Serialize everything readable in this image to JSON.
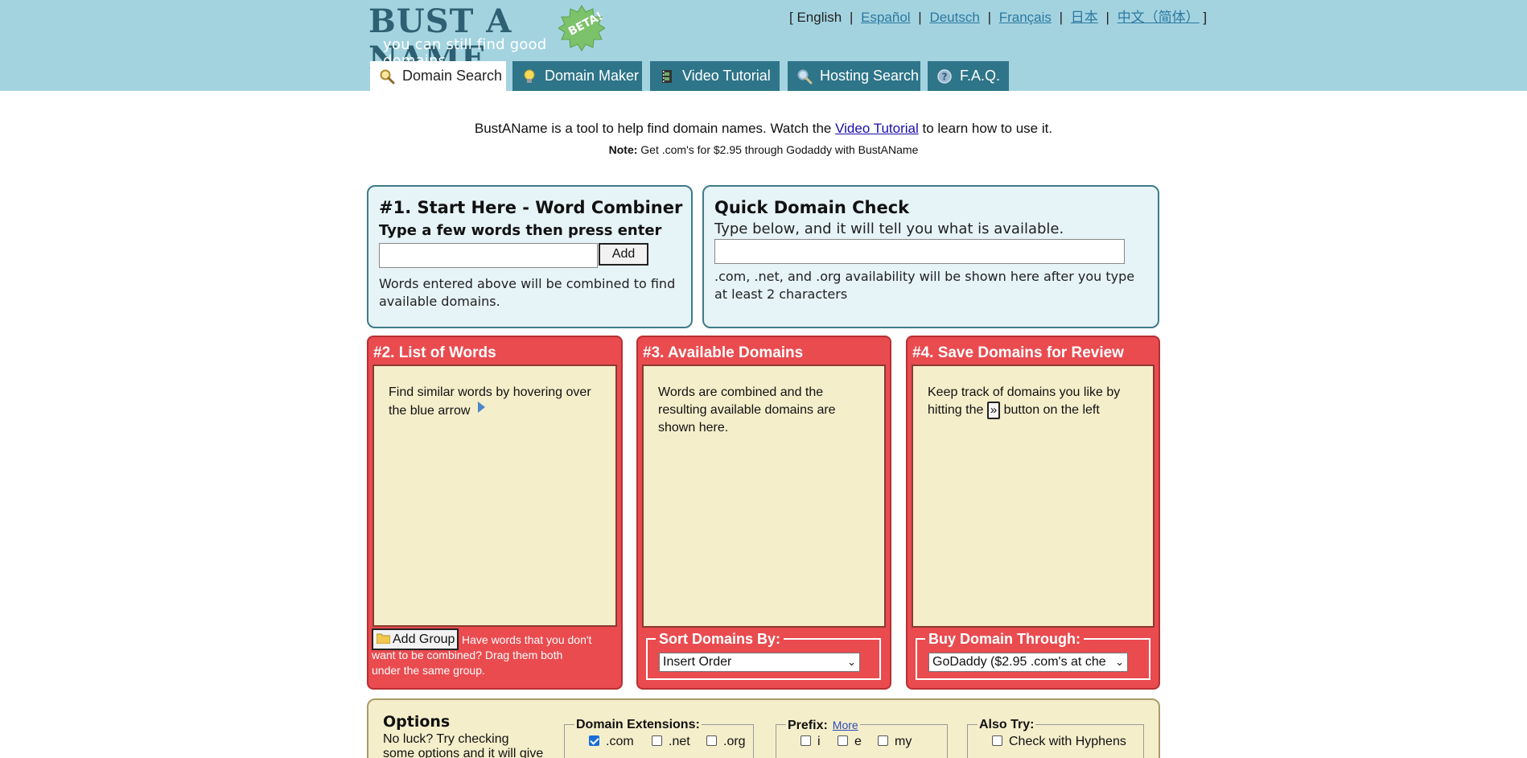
{
  "header": {
    "logo_title": "BUST A NAME",
    "logo_badge": "BETA!",
    "logo_tagline": "you can still find good domains",
    "languages": {
      "current": "English",
      "espanol": "Español",
      "deutsch": "Deutsch",
      "francais": "Français",
      "japanese": "日本",
      "chinese": "中文（简体）",
      "open_bracket": "[",
      "close_bracket": "]",
      "separator": "|"
    },
    "tabs": [
      {
        "label": "Domain Search",
        "icon": "magnifier-icon",
        "active": true
      },
      {
        "label": "Domain Maker",
        "icon": "lightbulb-icon",
        "active": false
      },
      {
        "label": "Video Tutorial",
        "icon": "film-icon",
        "active": false
      },
      {
        "label": "Hosting Search",
        "icon": "search-icon",
        "active": false
      },
      {
        "label": "F.A.Q.",
        "icon": "help-icon",
        "active": false
      }
    ]
  },
  "intro": {
    "before_link": "BustAName is a tool to help find domain names. Watch the ",
    "link": "Video Tutorial",
    "after_link": " to learn how to use it.",
    "note_label": "Note:",
    "note_text": " Get .com's for $2.95 through Godaddy with BustAName"
  },
  "word_combiner": {
    "title": "#1. Start Here - Word Combiner",
    "subtitle": "Type a few words then press enter",
    "input_value": "",
    "add_button": "Add",
    "help": "Words entered above will be combined to find available domains."
  },
  "quick_check": {
    "title": "Quick Domain Check",
    "subtitle": "Type below, and it will tell you what is available.",
    "input_value": "",
    "help": ".com, .net, and .org availability will be shown here after you type at least 2 characters"
  },
  "list_of_words": {
    "title": "#2. List of Words",
    "help": "Find similar words by hovering over the blue arrow",
    "add_group_button": "Add Group",
    "group_help_1": "Have words that you don't want to be combined?",
    "group_help_2": "Drag them both under the same group.",
    "group_help_line1": "Have words that you don't",
    "group_help_line2": "want to be combined?  Drag them both",
    "group_help_line3": "under the same group."
  },
  "available_domains": {
    "title": "#3. Available Domains",
    "help": "Words are combined and the resulting available domains are shown here.",
    "sort_legend": "Sort Domains By:",
    "sort_value": "Insert Order"
  },
  "save_domains": {
    "title": "#4. Save Domains for Review",
    "help_before": "Keep track of domains you like by hitting the ",
    "help_button": "»",
    "help_after": " button on the left",
    "buy_legend": "Buy Domain Through:",
    "buy_value": "GoDaddy ($2.95 .com's at che"
  },
  "options": {
    "title": "Options",
    "text": "No luck?  Try checking some options and it will give you",
    "extensions_legend": "Domain Extensions:",
    "extensions": [
      {
        "label": ".com",
        "checked": true
      },
      {
        "label": ".net",
        "checked": false
      },
      {
        "label": ".org",
        "checked": false
      }
    ],
    "prefix_legend": "Prefix:",
    "prefix_more": "More",
    "prefixes": [
      {
        "label": "i",
        "checked": false
      },
      {
        "label": "e",
        "checked": false
      },
      {
        "label": "my",
        "checked": false
      }
    ],
    "also_try_legend": "Also Try:",
    "also_try": [
      {
        "label": "Check with Hyphens",
        "checked": false
      }
    ]
  },
  "colors": {
    "header_bg": "#a4d3e0",
    "tab_bg": "#2e7589",
    "red_panel": "#e94b4f",
    "panel_cream": "#f5eecb",
    "blue_panel": "#e6f3f7"
  }
}
